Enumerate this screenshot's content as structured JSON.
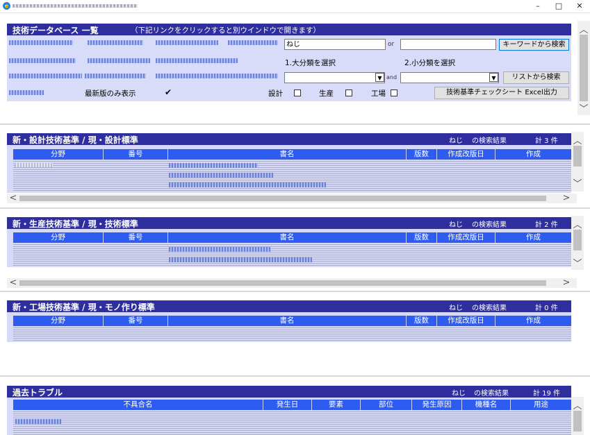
{
  "window": {
    "minimize": "–",
    "maximize": "□",
    "close": "✕"
  },
  "search": {
    "title": "技術データベース 一覧",
    "subtitle": "（下記リンクをクリックすると別ウインドウで開きます）",
    "keyword_value": "ねじ",
    "or_label": "or",
    "and_label": "and",
    "keyword_button": "キーワードから検索",
    "category1_label": "1.大分類を選択",
    "category2_label": "2.小分類を選択",
    "list_button": "リストから検索",
    "latest_only_label": "最新版のみ表示",
    "latest_only_checked": true,
    "filter_design": "設計",
    "filter_production": "生産",
    "filter_factory": "工場",
    "export_button": "技術基準チェックシート Excel出力"
  },
  "sections": [
    {
      "title": "新・設計技術基準 / 現・設計標準",
      "result_keyword": "ねじ",
      "result_label": "の検索結果",
      "count_text": "計 3 件",
      "columns": [
        "分野",
        "番号",
        "書名",
        "版数",
        "作成改版日",
        "作成"
      ]
    },
    {
      "title": "新・生産技術基準 / 現・技術標準",
      "result_keyword": "ねじ",
      "result_label": "の検索結果",
      "count_text": "計 2 件",
      "columns": [
        "分野",
        "番号",
        "書名",
        "版数",
        "作成改版日",
        "作成"
      ]
    },
    {
      "title": "新・工場技術基準 / 現・モノ作り標準",
      "result_keyword": "ねじ",
      "result_label": "の検索結果",
      "count_text": "計 0 件",
      "columns": [
        "分野",
        "番号",
        "書名",
        "版数",
        "作成改版日",
        "作成"
      ]
    },
    {
      "title": "過去トラブル",
      "result_keyword": "ねじ",
      "result_label": "の検索結果",
      "count_text": "計 19 件",
      "columns": [
        "不具合名",
        "発生日",
        "要素",
        "部位",
        "発生原因",
        "機種名",
        "用途"
      ]
    }
  ],
  "icons": {
    "app": "ie-icon",
    "scroll_up": "▲",
    "scroll_down": "▼",
    "scroll_left": "<",
    "scroll_right": ">",
    "chevron_up": "︿",
    "chevron_down": "﹀",
    "dropdown": "▼"
  },
  "colors": {
    "header_bar": "#2e2e9e",
    "table_header": "#2f5cf0",
    "panel_bg": "#d9dcf8"
  }
}
